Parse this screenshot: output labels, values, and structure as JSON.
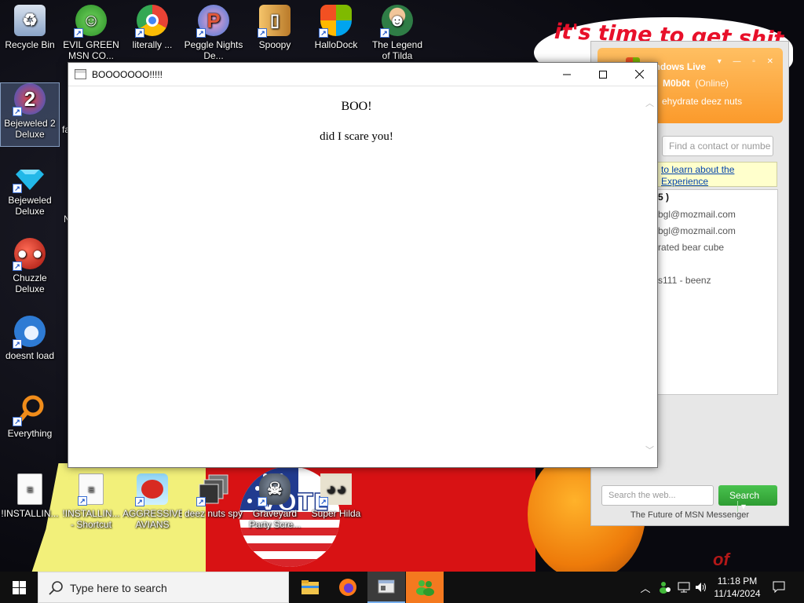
{
  "wallpaper": {
    "banner_text": "it's time to get shit",
    "sticker_text": "VOTE",
    "corner_text": "of"
  },
  "desktop_icons": [
    {
      "label": "Recycle Bin",
      "icon": "recycle-bin-icon",
      "color": "#8aa4c8"
    },
    {
      "label": "EVIL GREEN MSN CO...",
      "icon": "msn-buddy-icon",
      "color": "#3fae3a"
    },
    {
      "label": "literally ...",
      "icon": "chrome-icon",
      "color": "#e94335"
    },
    {
      "label": "Peggle Nights De...",
      "icon": "peggle-icon",
      "color": "#e2573a"
    },
    {
      "label": "Spoopy",
      "icon": "folder-icon",
      "color": "#e4a64a"
    },
    {
      "label": "HalloDock",
      "icon": "windows-logo-icon",
      "color": "#1f8ed6"
    },
    {
      "label": "The Legend of Tilda",
      "icon": "tilda-icon",
      "color": "#2f7d46"
    },
    {
      "label": "Bejeweled 2 Deluxe",
      "icon": "bejeweled2-icon",
      "color": "#2c5bd8"
    },
    {
      "label": "Bejeweled Deluxe",
      "icon": "diamond-icon",
      "color": "#22b8e8"
    },
    {
      "label": "Chuzzle Deluxe",
      "icon": "chuzzle-icon",
      "color": "#d42b1f"
    },
    {
      "label": "doesnt load",
      "icon": "thunderbird-icon",
      "color": "#2e7bd4"
    },
    {
      "label": "Everything",
      "icon": "magnifier-icon",
      "color": "#f08c1a"
    },
    {
      "label": "!INSTALLIN...",
      "icon": "document-icon",
      "color": "#f4f4f4"
    },
    {
      "label": "!INSTALLIN... - Shortcut",
      "icon": "document-icon",
      "color": "#f4f4f4"
    },
    {
      "label": "AGGRESSIVE AVIANS",
      "icon": "angry-bird-icon",
      "color": "#d82b22"
    },
    {
      "label": "deez nuts spy",
      "icon": "window-stack-icon",
      "color": "#3a3a3a"
    },
    {
      "label": "Graveyard Party Scre...",
      "icon": "robot-icon",
      "color": "#4d5a6a"
    },
    {
      "label": "Super Hilda",
      "icon": "pixel-cat-icon",
      "color": "#e8e2cf"
    }
  ],
  "hidden_label_fragments": {
    "near_bejeweled2": "fa",
    "near_bejeweled": "N"
  },
  "msn": {
    "title": "Windows Live",
    "username": "M0b0t",
    "status": "(Online)",
    "personal_message": "ehydrate deez nuts",
    "search_contacts_placeholder": "Find a contact or numbe",
    "banner_line1": "to learn about the",
    "banner_line2": "Experience",
    "group_header": "5 )",
    "contacts": [
      "bgl@mozmail.com",
      "bgl@mozmail.com",
      "rated bear cube",
      "",
      "s111 - beenz"
    ],
    "web_search_placeholder": "Search the web...",
    "search_button": "Search",
    "footer": "The Future of MSN Messenger"
  },
  "window": {
    "title": "BOOOOOOO!!!!!",
    "heading": "BOO!",
    "message": "did I scare you!"
  },
  "taskbar": {
    "search_placeholder": "Type here to search",
    "apps": [
      "file-explorer-icon",
      "firefox-icon",
      "window-app-icon",
      "msn-buddy-icon"
    ],
    "clock_time": "11:18 PM",
    "clock_date": "11/14/2024"
  }
}
